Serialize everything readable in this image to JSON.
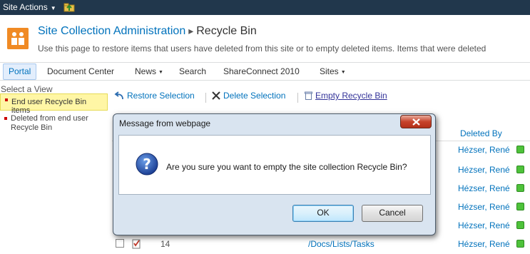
{
  "topbar": {
    "site_actions": "Site Actions"
  },
  "header": {
    "title": "Site Collection Administration",
    "current": "Recycle Bin",
    "separator": "▸",
    "description": "Use this page to restore items that users have deleted from this site or to empty deleted items. Items that were deleted"
  },
  "topnav": {
    "items": [
      {
        "label": "Portal"
      },
      {
        "label": "Document Center"
      },
      {
        "label": "News"
      },
      {
        "label": "Search"
      },
      {
        "label": "ShareConnect 2010"
      },
      {
        "label": "Sites"
      }
    ]
  },
  "leftnav": {
    "heading": "Select a View",
    "items": [
      {
        "label": "End user Recycle Bin items"
      },
      {
        "label": "Deleted from end user Recycle Bin"
      }
    ]
  },
  "toolbar": {
    "restore": "Restore Selection",
    "delete": "Delete Selection",
    "empty": "Empty Recycle Bin"
  },
  "list": {
    "col_deleted_by": "Deleted By",
    "rows": [
      {
        "user": "Hézser, René"
      },
      {
        "user": "Hézser, René"
      },
      {
        "user": "Hézser, René"
      },
      {
        "user": "Hézser, René"
      },
      {
        "user": "Hézser, René"
      },
      {
        "num": "14",
        "path": "/Docs/Lists/Tasks",
        "user": "Hézser, René"
      }
    ]
  },
  "dialog": {
    "title": "Message from webpage",
    "message": "Are you sure you want to empty the site collection Recycle Bin?",
    "ok": "OK",
    "cancel": "Cancel"
  }
}
